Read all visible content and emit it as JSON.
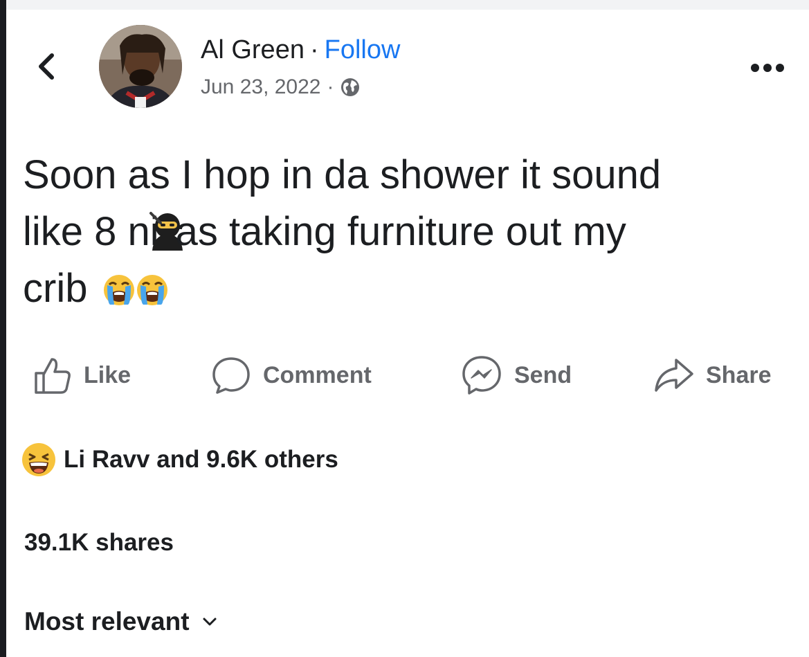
{
  "header": {
    "author_name": "Al Green",
    "separator": "·",
    "follow_label": "Follow",
    "date": "Jun 23, 2022",
    "privacy_icon": "globe-icon",
    "back_icon": "chevron-left-icon",
    "more_icon": "more-horizontal-icon"
  },
  "post": {
    "line1": "Soon as I hop in da shower it sound",
    "line2_before": "like 8 ni",
    "line2_after": "as taking furniture out my",
    "line3": "crib",
    "emoji_ninja": "ninja-emoji",
    "emoji_crying": "loudly-crying-face-emoji"
  },
  "actions": [
    {
      "label": "Like",
      "icon": "thumbs-up-icon"
    },
    {
      "label": "Comment",
      "icon": "comment-bubble-icon"
    },
    {
      "label": "Send",
      "icon": "messenger-icon"
    },
    {
      "label": "Share",
      "icon": "share-arrow-icon"
    }
  ],
  "reactions": {
    "emoji": "haha-reaction-icon",
    "summary": "Li Ravv and 9.6K others"
  },
  "shares": "39.1K shares",
  "comments_sort": {
    "label": "Most relevant",
    "icon": "chevron-down-icon"
  },
  "colors": {
    "accent": "#1877f2",
    "secondary_text": "#65676b",
    "primary_text": "#1c1e21"
  }
}
